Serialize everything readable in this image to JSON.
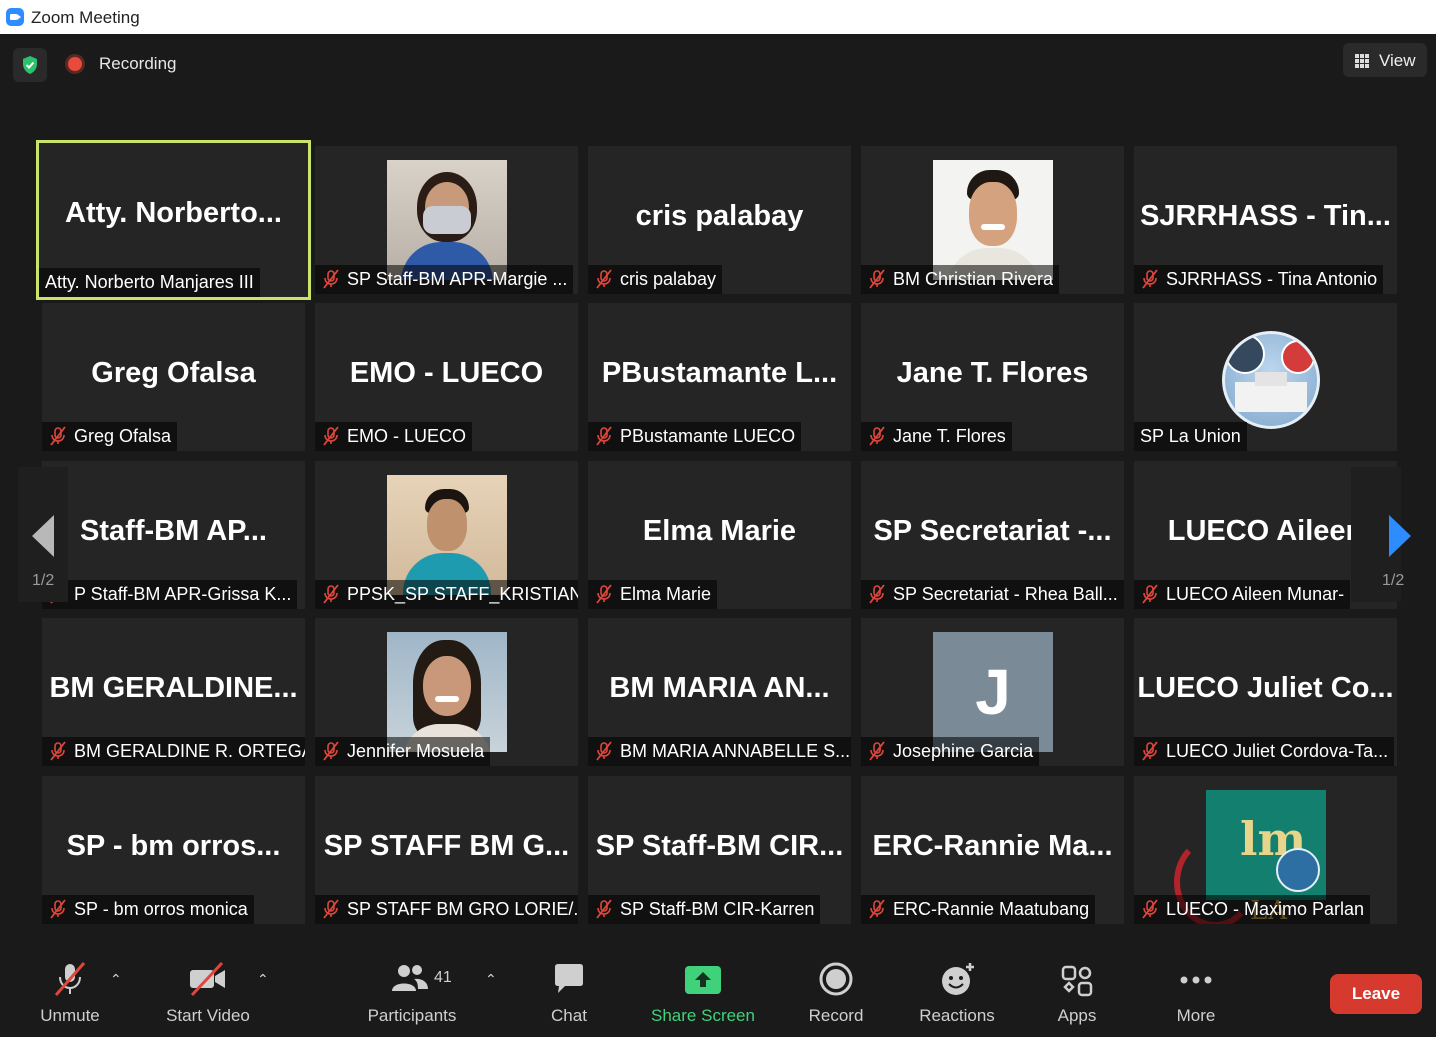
{
  "window": {
    "title": "Zoom Meeting"
  },
  "top": {
    "recording_label": "Recording",
    "view_label": "View"
  },
  "grid": {
    "page_indicator_left": "1/2",
    "page_indicator_right": "1/2",
    "tiles": [
      {
        "big": "Atty.  Norberto...",
        "label": "Atty. Norberto Manjares III",
        "muted": false,
        "active": true,
        "photo": null
      },
      {
        "big": "",
        "label": "SP Staff-BM APR-Margie ...",
        "muted": true,
        "active": false,
        "photo": "woman-mask"
      },
      {
        "big": "cris palabay",
        "label": "cris palabay",
        "muted": true,
        "active": false,
        "photo": null
      },
      {
        "big": "",
        "label": "BM Christian Rivera",
        "muted": true,
        "active": false,
        "photo": "man-smile"
      },
      {
        "big": "SJRRHASS  -  Tin...",
        "label": "SJRRHASS - Tina Antonio",
        "muted": true,
        "active": false,
        "photo": null
      },
      {
        "big": "Greg Ofalsa",
        "label": "Greg Ofalsa",
        "muted": true,
        "active": false,
        "photo": null
      },
      {
        "big": "EMO  -  LUECO",
        "label": "EMO - LUECO",
        "muted": true,
        "active": false,
        "photo": null
      },
      {
        "big": "PBustamante  L...",
        "label": "PBustamante LUECO",
        "muted": true,
        "active": false,
        "photo": null
      },
      {
        "big": "Jane T. Flores",
        "label": "Jane T. Flores",
        "muted": true,
        "active": false,
        "photo": null
      },
      {
        "big": "",
        "label": "SP La Union",
        "muted": false,
        "active": false,
        "photo": "building-circle"
      },
      {
        "big": "Staff-BM  AP...",
        "label": "P Staff-BM APR-Grissa K...",
        "muted": true,
        "active": false,
        "photo": null
      },
      {
        "big": "",
        "label": "PPSK_SP STAFF_KRISTIAN...",
        "muted": true,
        "active": false,
        "photo": "man-teal"
      },
      {
        "big": "Elma Marie",
        "label": "Elma Marie",
        "muted": true,
        "active": false,
        "photo": null
      },
      {
        "big": "SP  Secretariat  -...",
        "label": "SP Secretariat - Rhea Ball...",
        "muted": true,
        "active": false,
        "photo": null
      },
      {
        "big": "LUECO  Aileen",
        "label": "LUECO Aileen Munar-",
        "muted": true,
        "active": false,
        "photo": null
      },
      {
        "big": "BM  GERALDINE...",
        "label": "BM GERALDINE R. ORTEGA",
        "muted": true,
        "active": false,
        "photo": null
      },
      {
        "big": "",
        "label": "Jennifer Mosuela",
        "muted": true,
        "active": false,
        "photo": "woman-smile"
      },
      {
        "big": "BM  MARIA  AN...",
        "label": "BM MARIA ANNABELLE S....",
        "muted": true,
        "active": false,
        "photo": null
      },
      {
        "big": "J",
        "label": "Josephine Garcia",
        "muted": true,
        "active": false,
        "photo": "letter-avatar"
      },
      {
        "big": "LUECO  Juliet  Co...",
        "label": "LUECO Juliet Cordova-Ta...",
        "muted": true,
        "active": false,
        "photo": null
      },
      {
        "big": "SP  -  bm  orros...",
        "label": "SP - bm orros monica",
        "muted": true,
        "active": false,
        "photo": null
      },
      {
        "big": "SP  STAFF  BM  G...",
        "label": "SP STAFF BM GRO LORIE/...",
        "muted": true,
        "active": false,
        "photo": null
      },
      {
        "big": "SP  Staff-BM  CIR...",
        "label": "SP Staff-BM CIR-Karren",
        "muted": true,
        "active": false,
        "photo": null
      },
      {
        "big": "ERC-Rannie  Ma...",
        "label": "ERC-Rannie Maatubang",
        "muted": true,
        "active": false,
        "photo": null
      },
      {
        "big": "",
        "label": "LUECO - Maximo Parlan",
        "muted": true,
        "active": false,
        "photo": "la-union-logo",
        "logo_text": "LA UNION",
        "logo_mark": "lm"
      }
    ]
  },
  "toolbar": {
    "unmute": "Unmute",
    "start_video": "Start Video",
    "participants": "Participants",
    "participants_count": "41",
    "chat": "Chat",
    "share_screen": "Share Screen",
    "record": "Record",
    "reactions": "Reactions",
    "apps": "Apps",
    "more": "More",
    "leave": "Leave"
  },
  "colors": {
    "accent_green": "#3fd27a",
    "active_border": "#c9e36b",
    "leave_red": "#d63a2f",
    "mute_red": "#e0463b"
  }
}
